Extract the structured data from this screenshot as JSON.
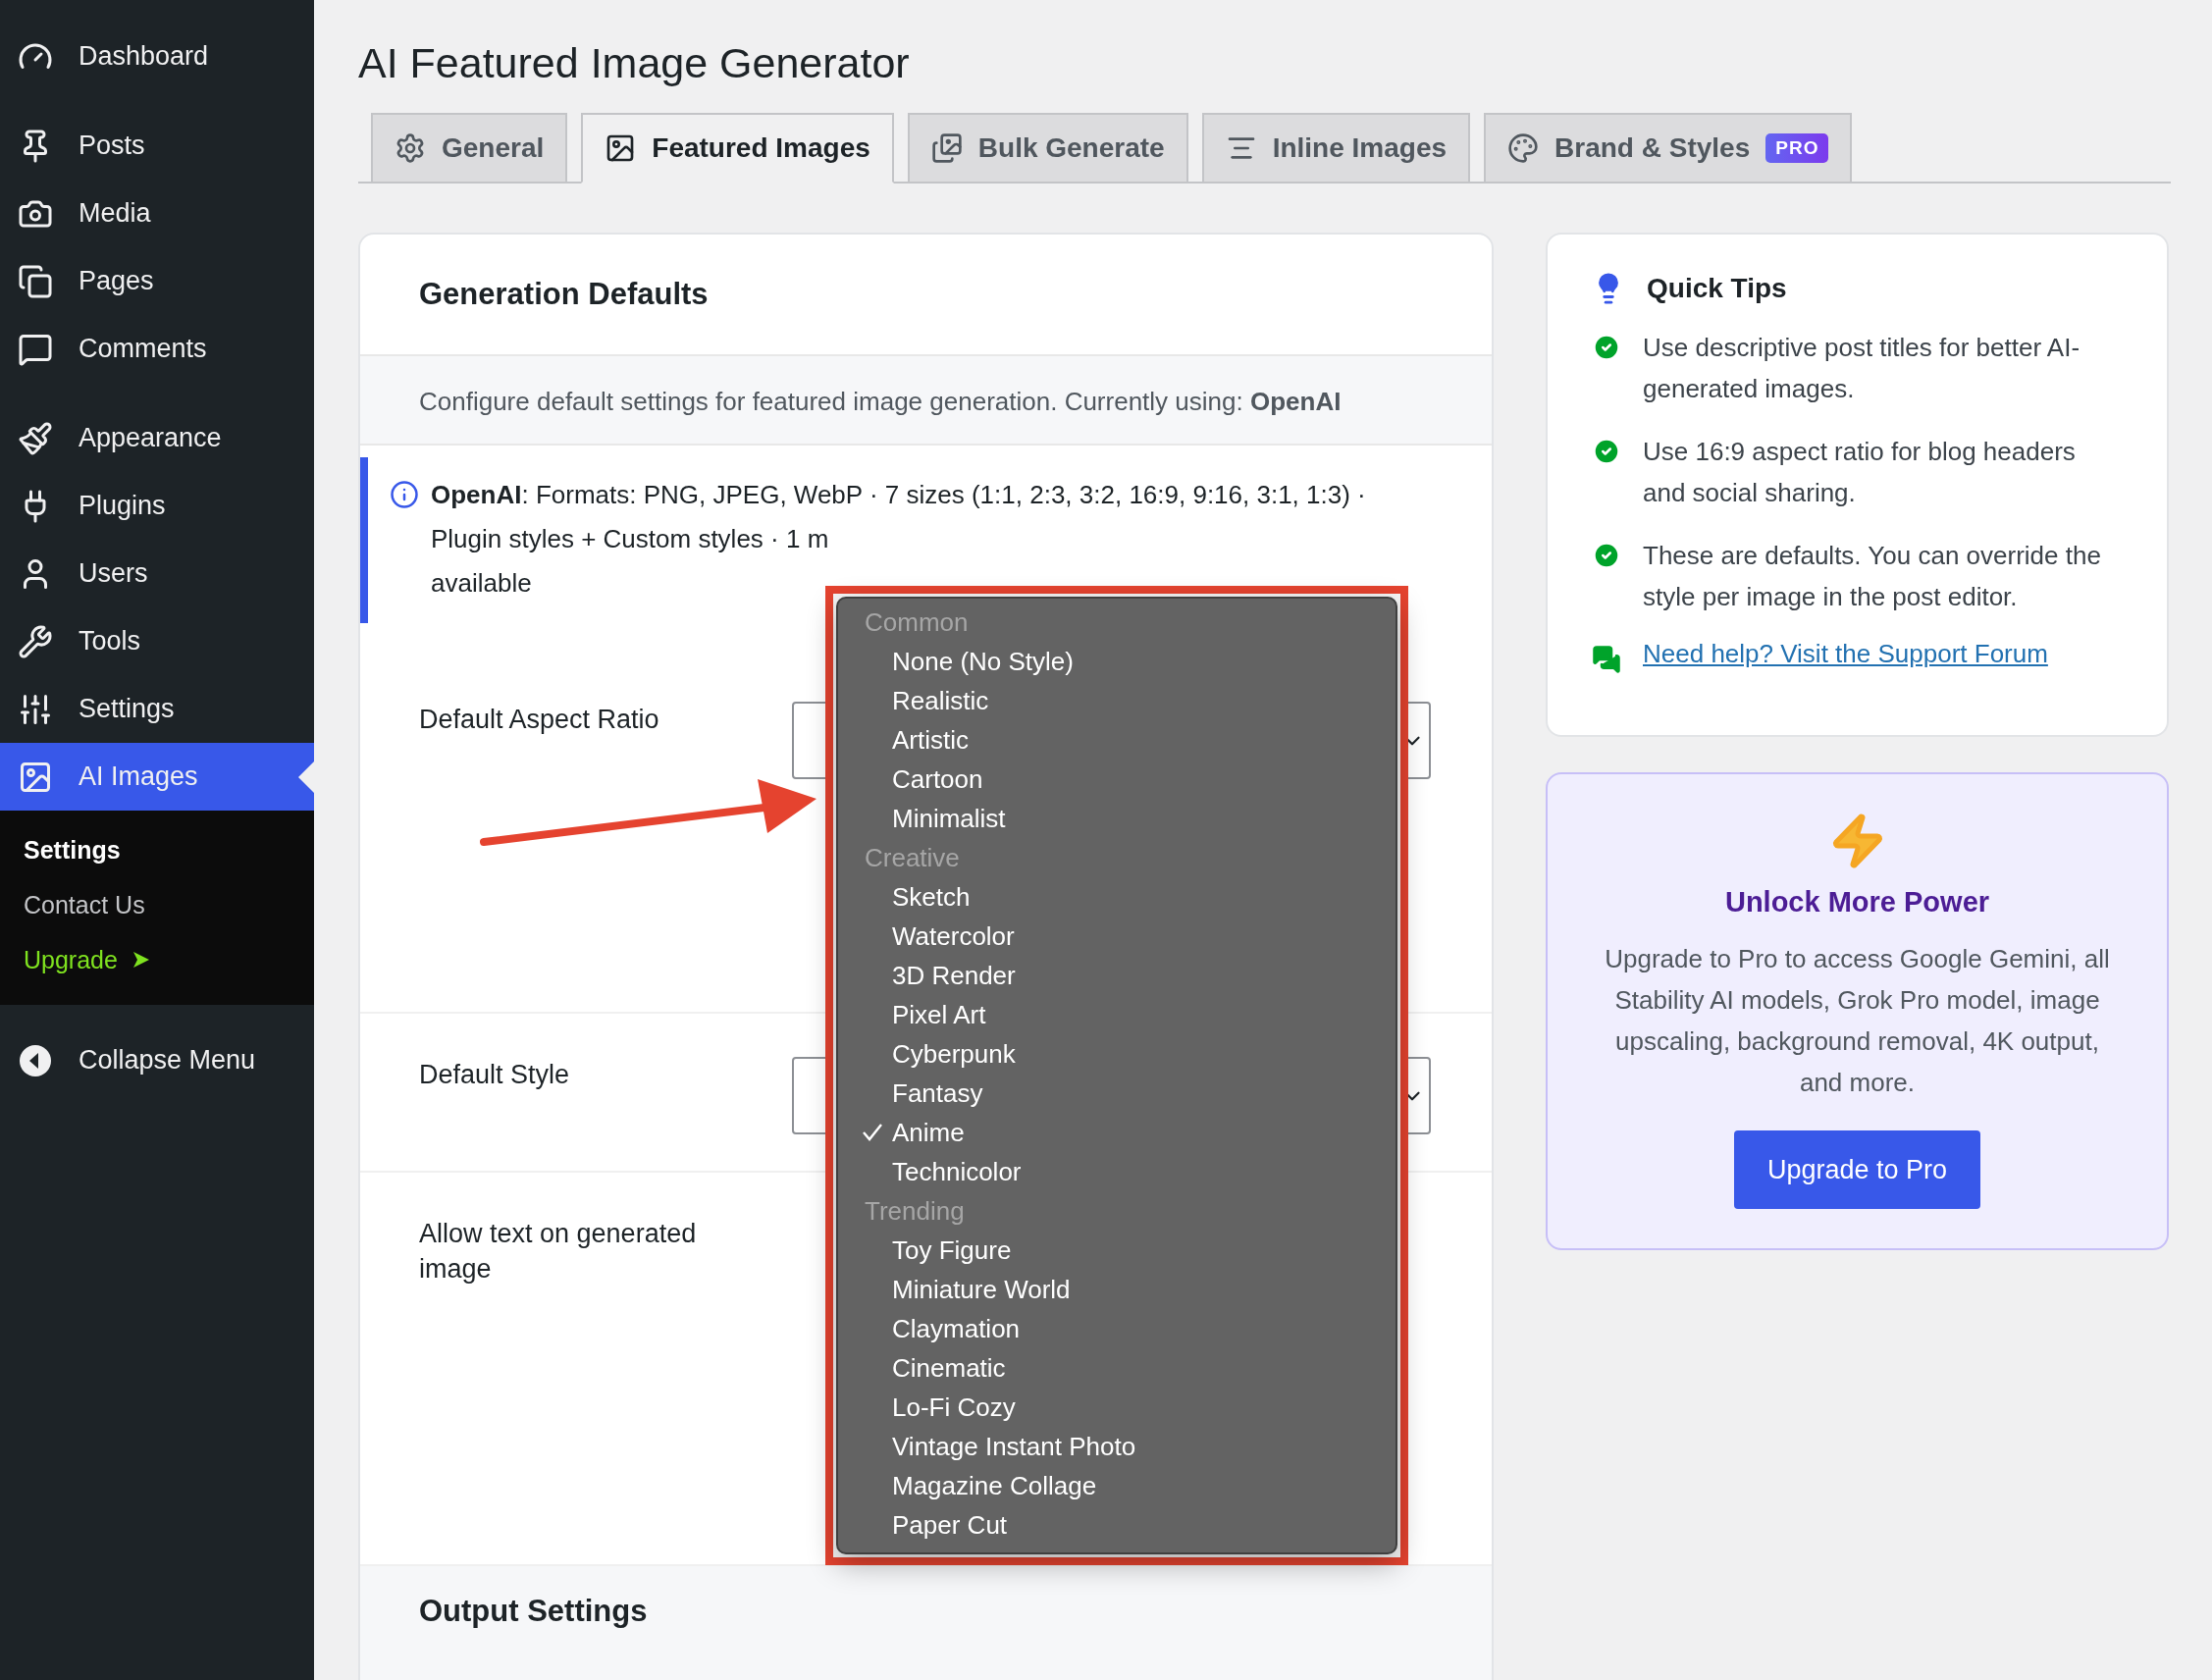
{
  "sidebar": {
    "groups": [
      {
        "items": [
          {
            "label": "Dashboard",
            "selected": false
          }
        ]
      },
      {
        "items": [
          {
            "label": "Posts",
            "selected": false
          },
          {
            "label": "Media",
            "selected": false
          },
          {
            "label": "Pages",
            "selected": false
          },
          {
            "label": "Comments",
            "selected": false
          }
        ]
      },
      {
        "items": [
          {
            "label": "Appearance",
            "selected": false
          },
          {
            "label": "Plugins",
            "selected": false
          },
          {
            "label": "Users",
            "selected": false
          },
          {
            "label": "Tools",
            "selected": false
          },
          {
            "label": "Settings",
            "selected": false
          },
          {
            "label": "AI Images",
            "selected": true,
            "children": [
              {
                "label": "Settings",
                "kind": "link",
                "selected": true
              },
              {
                "label": "Contact Us",
                "kind": "link",
                "selected": false
              },
              {
                "label": "Upgrade",
                "kind": "upgrade",
                "selected": false
              }
            ]
          }
        ]
      }
    ],
    "collapse": "Collapse Menu"
  },
  "page_title": "AI Featured Image Generator",
  "tabs": [
    {
      "label": "General",
      "selected": false
    },
    {
      "label": "Featured Images",
      "selected": true
    },
    {
      "label": "Bulk Generate",
      "selected": false
    },
    {
      "label": "Inline Images",
      "selected": false
    },
    {
      "label": "Brand & Styles",
      "selected": false,
      "badge": "PRO"
    }
  ],
  "settings_card": {
    "title": "Generation Defaults",
    "description": "Configure default settings for featured image generation. Currently using: **OpenAI**",
    "info": "**OpenAI**: Formats: PNG, JPEG, WebP · 7 sizes (1:1, 2:3, 3:2, 16:9, 9:16, 3:1, 1:3) ·\nPlugin styles + Custom styles · 1 m\navailable",
    "fields": [
      {
        "label": "Default Aspect Ratio",
        "kind": "select"
      },
      {
        "label": "Default Style",
        "kind": "select"
      },
      {
        "label": "Allow text on generated image",
        "kind": "option"
      }
    ],
    "next_section": "Output Settings"
  },
  "style_menu": {
    "groups": [
      {
        "label": "Common",
        "options": [
          {
            "label": "None (No Style)",
            "selected": false
          },
          {
            "label": "Realistic",
            "selected": false
          },
          {
            "label": "Artistic",
            "selected": false
          },
          {
            "label": "Cartoon",
            "selected": false
          },
          {
            "label": "Minimalist",
            "selected": false
          }
        ]
      },
      {
        "label": "Creative",
        "options": [
          {
            "label": "Sketch",
            "selected": false
          },
          {
            "label": "Watercolor",
            "selected": false
          },
          {
            "label": "3D Render",
            "selected": false
          },
          {
            "label": "Pixel Art",
            "selected": false
          },
          {
            "label": "Cyberpunk",
            "selected": false
          },
          {
            "label": "Fantasy",
            "selected": false
          },
          {
            "label": "Anime",
            "selected": true
          },
          {
            "label": "Technicolor",
            "selected": false
          }
        ]
      },
      {
        "label": "Trending",
        "options": [
          {
            "label": "Toy Figure",
            "selected": false
          },
          {
            "label": "Miniature World",
            "selected": false
          },
          {
            "label": "Claymation",
            "selected": false
          },
          {
            "label": "Cinematic",
            "selected": false
          },
          {
            "label": "Lo-Fi Cozy",
            "selected": false
          },
          {
            "label": "Vintage Instant Photo",
            "selected": false
          },
          {
            "label": "Magazine Collage",
            "selected": false
          },
          {
            "label": "Paper Cut",
            "selected": false
          }
        ]
      }
    ]
  },
  "quick_tips": {
    "title": "Quick Tips",
    "tips": [
      "Use descriptive post titles for better AI-generated images.",
      "Use 16:9 aspect ratio for blog headers and social sharing.",
      "These are defaults. You can override the style per image in the post editor."
    ],
    "link": "Need help? Visit the Support Forum"
  },
  "pro_card": {
    "title": "Unlock More Power",
    "text": "Upgrade to Pro to access Google Gemini, all Stability AI models, Grok Pro model, image upscaling, background removal, 4K output, and more.",
    "button": "Upgrade to Pro"
  }
}
